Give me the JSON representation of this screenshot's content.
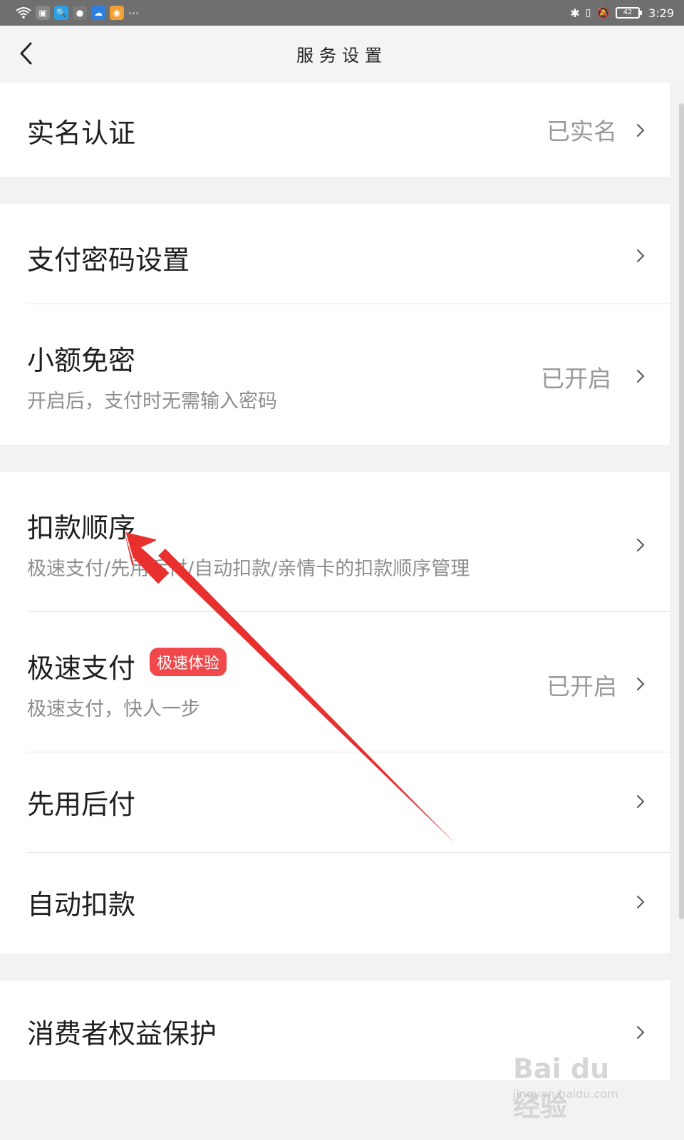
{
  "status_bar": {
    "time": "3:29",
    "battery": "42",
    "more": "···",
    "icons": [
      "wifi-icon",
      "sim-icon",
      "search-app-icon",
      "wechat-icon",
      "cloud-icon",
      "weibo-icon",
      "bluetooth-icon",
      "vibrate-icon",
      "mute-icon",
      "battery-icon"
    ]
  },
  "nav": {
    "title": "服务设置",
    "back_icon": "chevron-left-icon"
  },
  "sections": {
    "identity": {
      "title": "实名认证",
      "value": "已实名"
    },
    "password": {
      "title": "支付密码设置"
    },
    "small_free": {
      "title": "小额免密",
      "subtitle": "开启后，支付时无需输入密码",
      "value": "已开启"
    },
    "deduct_order": {
      "title": "扣款顺序",
      "subtitle": "极速支付/先用后付/自动扣款/亲情卡的扣款顺序管理"
    },
    "fast_pay": {
      "title": "极速支付",
      "badge": "极速体验",
      "subtitle": "极速支付，快人一步",
      "value": "已开启"
    },
    "pay_later": {
      "title": "先用后付"
    },
    "auto_deduct": {
      "title": "自动扣款"
    },
    "consumer": {
      "title": "消费者权益保护"
    }
  },
  "watermark": {
    "main": "Bai du 经验",
    "sub": "jingyan.baidu.com"
  },
  "colors": {
    "badge": "#f0484b",
    "arrow": "#e8312f",
    "status_bar": "#6f6f6f"
  }
}
